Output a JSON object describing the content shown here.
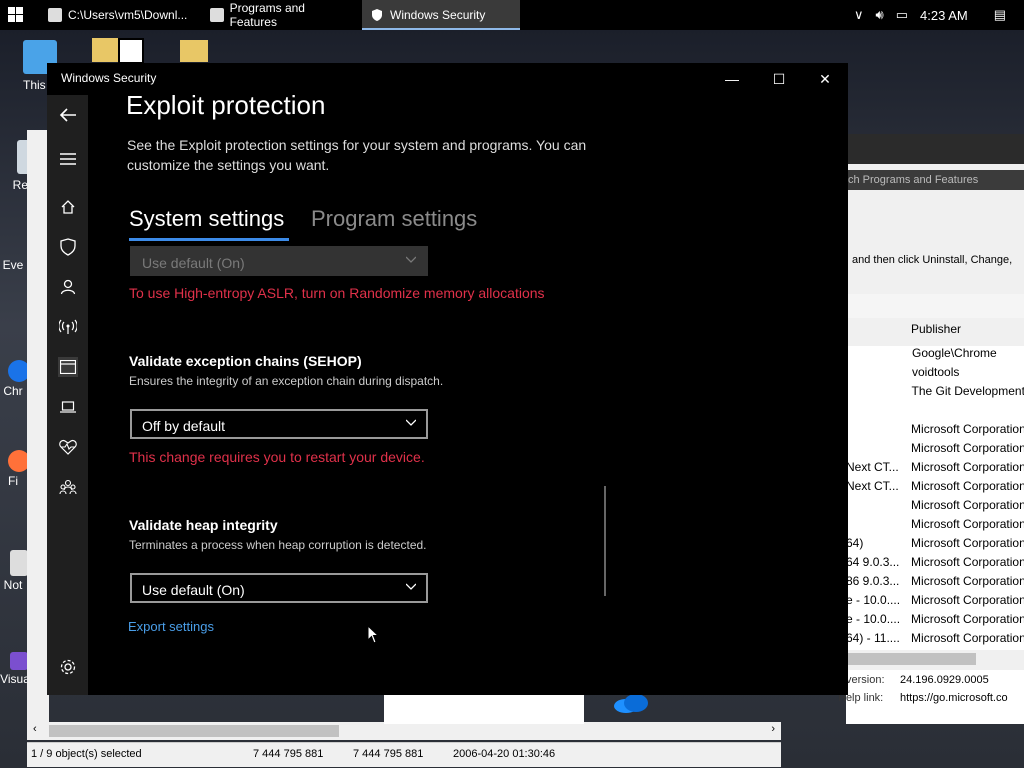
{
  "taskbar": {
    "tasks": [
      {
        "label": "C:\\Users\\vm5\\Downl..."
      },
      {
        "label": "Programs and Features"
      },
      {
        "label": "Windows Security"
      }
    ],
    "time": "4:23 AM"
  },
  "desktop": {
    "icons": [
      "This P",
      "Recycle",
      "Eve",
      "Chr",
      "Fi",
      "Not",
      "Visua"
    ]
  },
  "window": {
    "title": "Windows Security",
    "controls": {
      "minimize": "—",
      "maximize": "☐",
      "close": "✕"
    }
  },
  "page": {
    "title": "Exploit protection",
    "description": "See the Exploit protection settings for your system and programs.  You can customize the settings you want.",
    "tabs": [
      {
        "label": "System settings",
        "selected": true
      },
      {
        "label": "Program settings",
        "selected": false
      }
    ],
    "sections": {
      "aslr_dropdown": {
        "value": "Use default (On)",
        "disabled": true
      },
      "aslr_warning": "To use High-entropy ASLR, turn on Randomize memory allocations",
      "sehop": {
        "title": "Validate exception chains (SEHOP)",
        "desc": "Ensures the integrity of an exception chain during dispatch.",
        "value": "Off by default",
        "warning": "This change requires you to restart your device."
      },
      "heap": {
        "title": "Validate heap integrity",
        "desc": "Terminates a process when heap corruption is detected.",
        "value": "Use default (On)"
      }
    },
    "export_link": "Export settings"
  },
  "nav_icons": [
    "back-arrow-icon",
    "hamburger-menu-icon",
    "home-icon",
    "shield-icon",
    "account-icon",
    "wireless-icon",
    "app-browser-icon",
    "device-security-icon",
    "health-heart-icon",
    "family-icon",
    "settings-gear-icon"
  ],
  "programs": {
    "search_placeholder": "ch Programs and Features",
    "hint": "and then click Uninstall, Change,",
    "column_publisher": "Publisher",
    "rows": [
      {
        "c1": "",
        "c2": "Google\\Chrome"
      },
      {
        "c1": "",
        "c2": "voidtools"
      },
      {
        "c1": "",
        "c2": "The Git Development"
      },
      {
        "c1": "",
        "c2": ""
      },
      {
        "c1": "",
        "c2": "Microsoft Corporation"
      },
      {
        "c1": "",
        "c2": "Microsoft Corporation"
      },
      {
        "c1": "Next CT...",
        "c2": "Microsoft Corporation"
      },
      {
        "c1": "Next CT...",
        "c2": "Microsoft Corporation"
      },
      {
        "c1": "",
        "c2": "Microsoft Corporation"
      },
      {
        "c1": "",
        "c2": "Microsoft Corporation"
      },
      {
        "c1": "64)",
        "c2": "Microsoft Corporation"
      },
      {
        "c1": "64 9.0.3...",
        "c2": "Microsoft Corporation"
      },
      {
        "c1": "86 9.0.3...",
        "c2": "Microsoft Corporation"
      },
      {
        "c1": "e - 10.0....",
        "c2": "Microsoft Corporation"
      },
      {
        "c1": "e - 10.0....",
        "c2": "Microsoft Corporation"
      },
      {
        "c1": "64) - 11....",
        "c2": "Microsoft Corporation"
      }
    ],
    "version_label": "version:",
    "version_value": "24.196.0929.0005",
    "help_label": "Help link:",
    "help_value": "https://go.microsoft.co"
  },
  "explorer_status": {
    "selected": "1 / 9 object(s) selected",
    "size1": "7 444 795 881",
    "size2": "7 444 795 881",
    "date": "2006-04-20 01:30:46"
  },
  "colors": {
    "accent": "#3c8be8",
    "error": "#e0314a",
    "link": "#4a9ee8"
  }
}
